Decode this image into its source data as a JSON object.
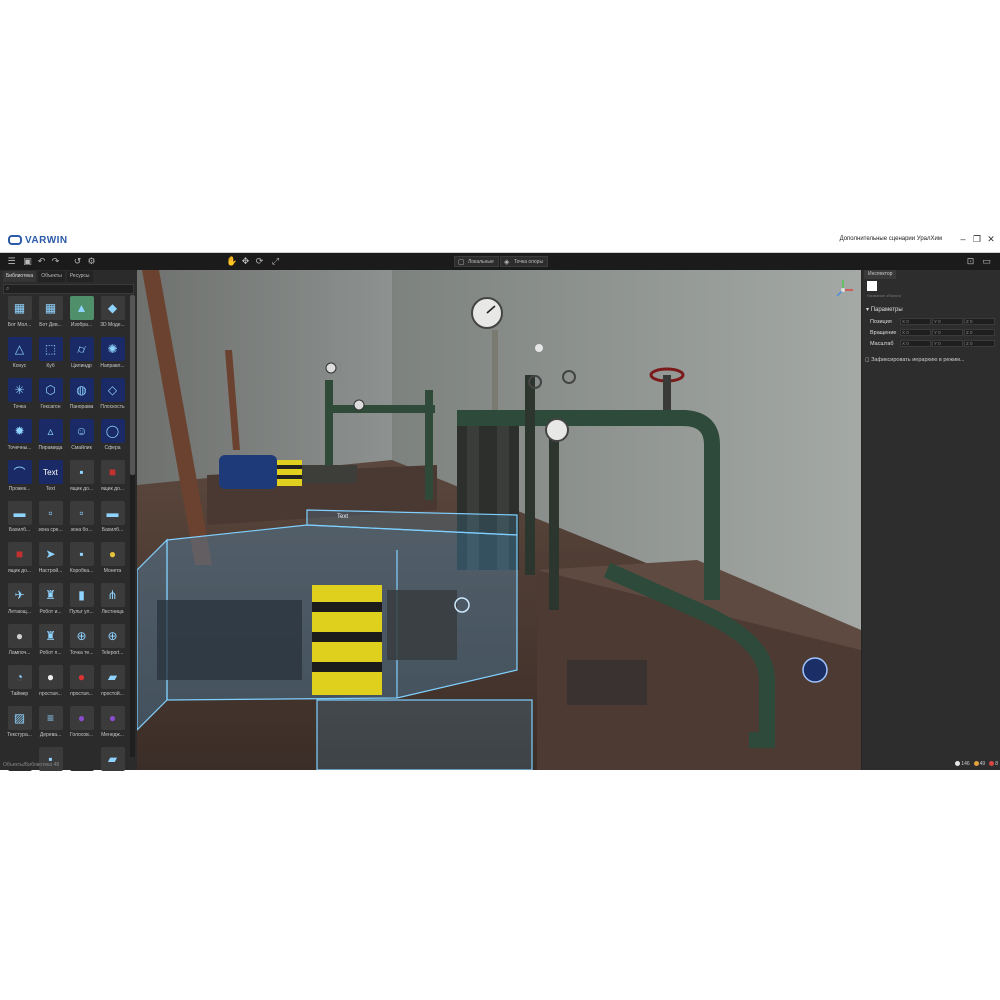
{
  "app": {
    "brand": "VARWIN",
    "window_title": "Дополнительные сценарии УралХим",
    "window_controls": [
      "minimize",
      "restore",
      "close"
    ]
  },
  "toolbar": {
    "left_icons": [
      "menu-icon",
      "save-icon",
      "undo-icon",
      "redo-icon",
      "undo2-icon",
      "settings-icon"
    ],
    "transform_icons": [
      "hand-icon",
      "move-icon",
      "rotate-icon",
      "scale-icon"
    ],
    "buttons": [
      {
        "label": "Локальные",
        "icon": "cube-icon"
      },
      {
        "label": "Точка опоры",
        "icon": "pivot-icon"
      }
    ],
    "right_icons": [
      "vr-icon",
      "preview-icon"
    ]
  },
  "left_panel": {
    "tabs": [
      "Библиотека",
      "Объекты",
      "Ресурсы"
    ],
    "search_placeholder": "",
    "items": [
      {
        "label": "Бот Мол...",
        "icon": "bot-icon",
        "color": "#3b3b3b"
      },
      {
        "label": "Бот Дев...",
        "icon": "bot-icon",
        "color": "#3b3b3b"
      },
      {
        "label": "Изобра...",
        "icon": "image-icon",
        "color": "#4f8f6a"
      },
      {
        "label": "3D Моде...",
        "icon": "model-icon",
        "color": "#3b3b3b"
      },
      {
        "label": "Конус",
        "icon": "cone-icon",
        "color": "#1a2a66"
      },
      {
        "label": "Куб",
        "icon": "cube-icon",
        "color": "#1a2a66"
      },
      {
        "label": "Цилиндр",
        "icon": "cylinder-icon",
        "color": "#1a2a66"
      },
      {
        "label": "Направл...",
        "icon": "light-icon",
        "color": "#1a2a66"
      },
      {
        "label": "Точка",
        "icon": "point-light-icon",
        "color": "#1a2a66"
      },
      {
        "label": "Гексагон",
        "icon": "hexagon-icon",
        "color": "#1a2a66"
      },
      {
        "label": "Панорама",
        "icon": "panorama-icon",
        "color": "#1a2a66"
      },
      {
        "label": "Плоскость",
        "icon": "plane-icon",
        "color": "#1a2a66"
      },
      {
        "label": "Точечны...",
        "icon": "spot-light-icon",
        "color": "#1a2a66"
      },
      {
        "label": "Пирамида",
        "icon": "pyramid-icon",
        "color": "#1a2a66"
      },
      {
        "label": "Смайлик",
        "icon": "smiley-icon",
        "color": "#1a2a66"
      },
      {
        "label": "Сфера",
        "icon": "sphere-icon",
        "color": "#1a2a66"
      },
      {
        "label": "Прожек...",
        "icon": "projector-icon",
        "color": "#1a2a66"
      },
      {
        "label": "Text",
        "icon": "text-icon",
        "color": "#1a2a66"
      },
      {
        "label": "ящик до...",
        "icon": "box-icon",
        "color": "#3b3b3b"
      },
      {
        "label": "ящик до...",
        "icon": "box-red-icon",
        "color": "#3b3b3b"
      },
      {
        "label": "Бахилб...",
        "icon": "bench-icon",
        "color": "#3b3b3b"
      },
      {
        "label": "зона сре...",
        "icon": "zone-icon",
        "color": "#3b3b3b"
      },
      {
        "label": "зона бо...",
        "icon": "zone-icon",
        "color": "#3b3b3b"
      },
      {
        "label": "Бахилб...",
        "icon": "bench-icon",
        "color": "#3b3b3b"
      },
      {
        "label": "ящик до...",
        "icon": "box-red-icon",
        "color": "#3b3b3b"
      },
      {
        "label": "Настрой...",
        "icon": "cursor-icon",
        "color": "#3b3b3b"
      },
      {
        "label": "Коробка...",
        "icon": "box-icon",
        "color": "#3b3b3b"
      },
      {
        "label": "Монета",
        "icon": "coin-icon",
        "color": "#3b3b3b"
      },
      {
        "label": "Летающ...",
        "icon": "drone-icon",
        "color": "#3b3b3b"
      },
      {
        "label": "Робот и...",
        "icon": "robot-icon",
        "color": "#3b3b3b"
      },
      {
        "label": "Пульт ул...",
        "icon": "remote-icon",
        "color": "#3b3b3b"
      },
      {
        "label": "Лестница",
        "icon": "ladder-icon",
        "color": "#3b3b3b"
      },
      {
        "label": "Лампоч...",
        "icon": "bulb-icon",
        "color": "#3b3b3b"
      },
      {
        "label": "Робот п...",
        "icon": "robot-icon",
        "color": "#3b3b3b"
      },
      {
        "label": "Точка те...",
        "icon": "teleport-icon",
        "color": "#3b3b3b"
      },
      {
        "label": "Teleport...",
        "icon": "teleport-icon",
        "color": "#3b3b3b"
      },
      {
        "label": "Таймер",
        "icon": "timer-icon",
        "color": "#3b3b3b"
      },
      {
        "label": "простая...",
        "icon": "lamp-icon",
        "color": "#3b3b3b"
      },
      {
        "label": "простая...",
        "icon": "button-red-icon",
        "color": "#3b3b3b"
      },
      {
        "label": "простой...",
        "icon": "panel-icon",
        "color": "#3b3b3b"
      },
      {
        "label": "Текстура...",
        "icon": "texture-icon",
        "color": "#3b3b3b"
      },
      {
        "label": "Дерева...",
        "icon": "wood-icon",
        "color": "#3b3b3b"
      },
      {
        "label": "Голосов...",
        "icon": "voice-icon",
        "color": "#3b3b3b"
      },
      {
        "label": "Менедж...",
        "icon": "manager-icon",
        "color": "#3b3b3b"
      },
      {
        "label": "",
        "icon": "blank-icon",
        "color": "#2b2b2b"
      },
      {
        "label": "",
        "icon": "box-icon",
        "color": "#3b3b3b"
      },
      {
        "label": "",
        "icon": "blank-icon",
        "color": "#2b2b2b"
      },
      {
        "label": "",
        "icon": "panel-icon",
        "color": "#3b3b3b"
      }
    ],
    "status": "Объекты/Библиотека 48"
  },
  "viewport": {
    "selection_label": "Text",
    "scene_colors": {
      "wall": "#8a8f8e",
      "floor": "#4a3a33",
      "pipe": "#2e4a3a",
      "selection": "#5fc4ff",
      "motor": "#1e3a78",
      "hazard": "#e6d21a"
    }
  },
  "inspector": {
    "tab": "Инспектор",
    "object_name": "Название объекта",
    "section": "Параметры",
    "rows": [
      {
        "label": "Позиция",
        "fields": [
          "X 0",
          "Y 0",
          "Z 0"
        ]
      },
      {
        "label": "Вращение",
        "fields": [
          "X 0",
          "Y 0",
          "Z 0"
        ]
      },
      {
        "label": "Масштаб",
        "fields": [
          "X 0",
          "Y 0",
          "Z 0"
        ]
      }
    ],
    "fix_hierarchy": "Зафиксировать иерархию в режим..."
  },
  "status_bar": {
    "stats": [
      {
        "label": "146",
        "color": "#e6e6e6"
      },
      {
        "label": "49",
        "color": "#e2a23b"
      },
      {
        "label": "8",
        "color": "#d94545"
      }
    ]
  }
}
